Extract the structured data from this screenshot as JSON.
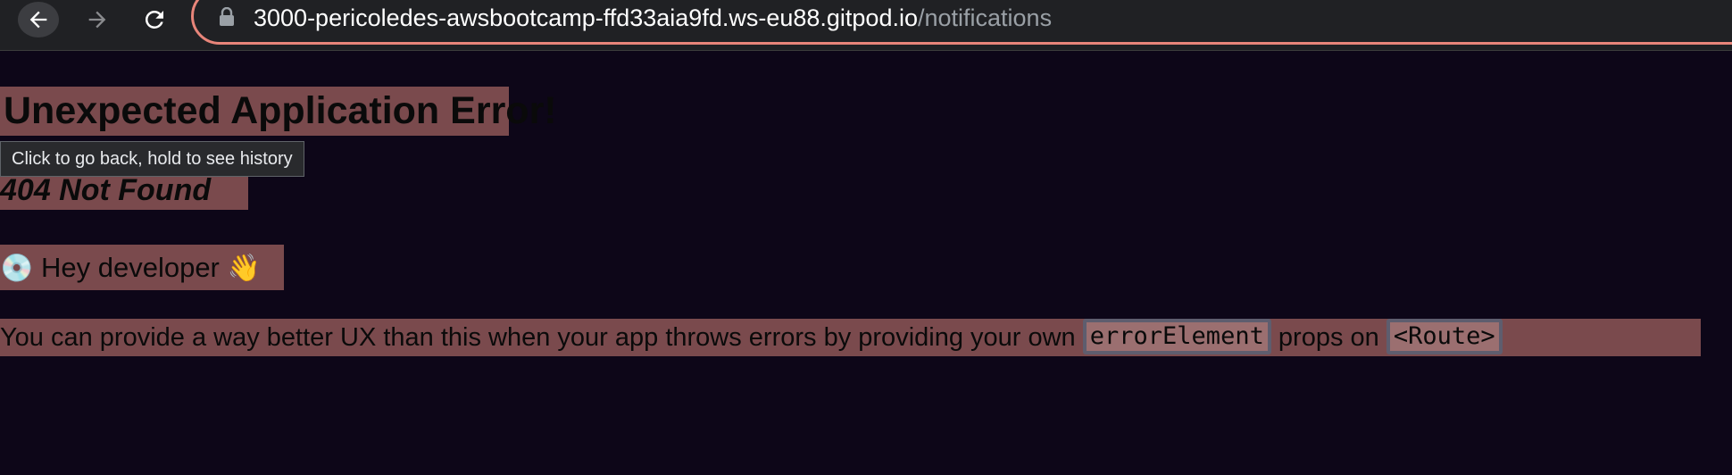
{
  "browser": {
    "url_host": "3000-pericoledes-awsbootcamp-ffd33aia9fd.ws-eu88.gitpod.io",
    "url_path": "/notifications",
    "back_icon": "arrow-left-icon",
    "forward_icon": "arrow-right-icon",
    "reload_icon": "reload-icon",
    "lock_icon": "lock-icon",
    "back_tooltip": "Click to go back, hold to see history",
    "omnibox_border_color": "#e8857a"
  },
  "page": {
    "heading": "Unexpected Application Error!",
    "subheading": "404 Not Found",
    "greeting_icon": "💿",
    "greeting_text": "Hey developer",
    "greeting_emoji": "👋",
    "help_prefix": "You can provide a way better UX than this when your app throws errors by providing your own",
    "help_code_1": "errorElement",
    "help_middle": "props on",
    "help_code_2": "<Route>",
    "highlight_color": "#7a4a4d",
    "background_color": "#0d0618"
  }
}
